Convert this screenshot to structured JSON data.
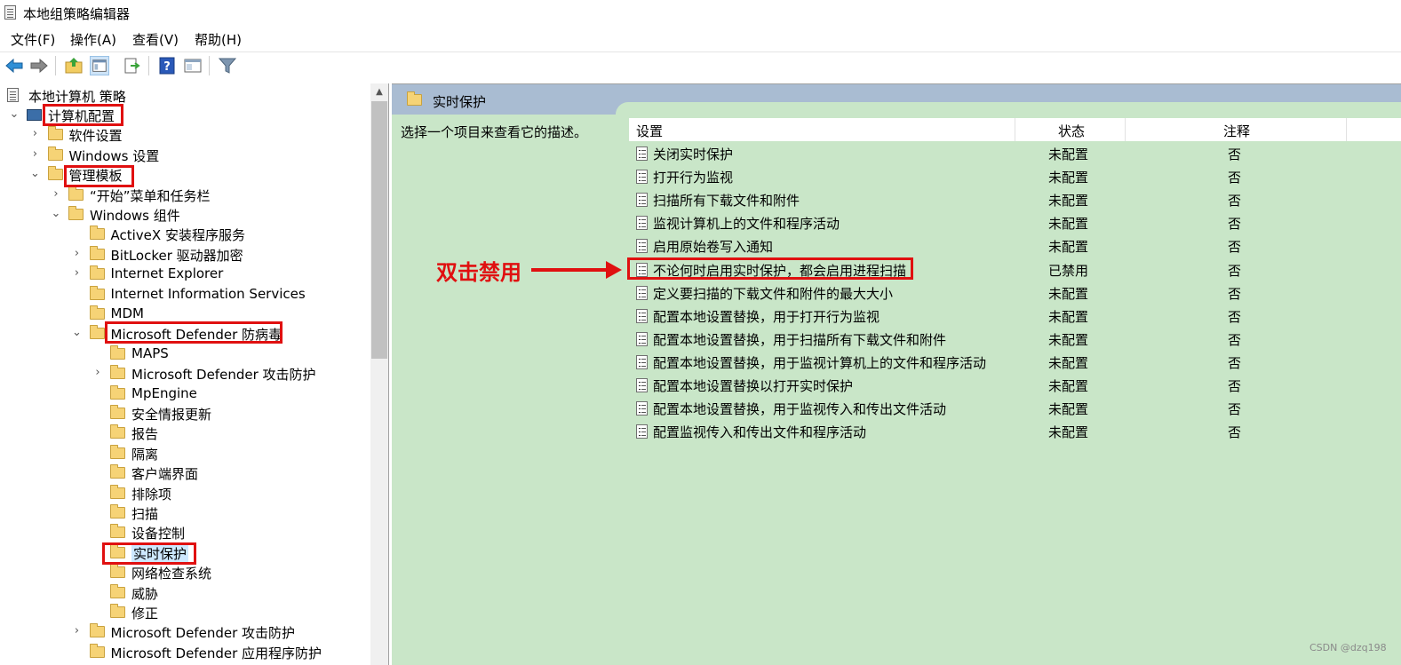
{
  "window": {
    "title": "本地组策略编辑器"
  },
  "menu": [
    "文件(F)",
    "操作(A)",
    "查看(V)",
    "帮助(H)"
  ],
  "toolbar": {
    "buttons": [
      "back-icon",
      "forward-icon",
      "up-folder-icon",
      "show-hide-tree-icon",
      "export-list-icon",
      "help-icon",
      "properties-icon",
      "filter-icon"
    ]
  },
  "tree": {
    "root": "本地计算机 策略",
    "items": [
      {
        "label": "计算机配置",
        "expander": "⌄"
      },
      {
        "label": "软件设置",
        "expander": "›"
      },
      {
        "label": "Windows 设置",
        "expander": "›"
      },
      {
        "label": "管理模板",
        "expander": "⌄"
      },
      {
        "label": "“开始”菜单和任务栏",
        "expander": "›"
      },
      {
        "label": "Windows 组件",
        "expander": "⌄"
      },
      {
        "label": "ActiveX 安装程序服务",
        "expander": ""
      },
      {
        "label": "BitLocker 驱动器加密",
        "expander": "›"
      },
      {
        "label": "Internet Explorer",
        "expander": "›"
      },
      {
        "label": "Internet Information Services",
        "expander": ""
      },
      {
        "label": "MDM",
        "expander": ""
      },
      {
        "label": "Microsoft Defender 防病毒",
        "expander": "⌄"
      },
      {
        "label": "MAPS",
        "expander": ""
      },
      {
        "label": "Microsoft Defender 攻击防护",
        "expander": "›"
      },
      {
        "label": "MpEngine",
        "expander": ""
      },
      {
        "label": "安全情报更新",
        "expander": ""
      },
      {
        "label": "报告",
        "expander": ""
      },
      {
        "label": "隔离",
        "expander": ""
      },
      {
        "label": "客户端界面",
        "expander": ""
      },
      {
        "label": "排除项",
        "expander": ""
      },
      {
        "label": "扫描",
        "expander": ""
      },
      {
        "label": "设备控制",
        "expander": ""
      },
      {
        "label": "实时保护",
        "expander": ""
      },
      {
        "label": "网络检查系统",
        "expander": ""
      },
      {
        "label": "威胁",
        "expander": ""
      },
      {
        "label": "修正",
        "expander": ""
      },
      {
        "label": "Microsoft Defender 攻击防护",
        "expander": "›"
      },
      {
        "label": "Microsoft Defender 应用程序防护",
        "expander": ""
      }
    ]
  },
  "details": {
    "header": "实时保护",
    "description": "选择一个项目来查看它的描述。",
    "columns": {
      "setting": "设置",
      "state": "状态",
      "comment": "注释"
    },
    "rows": [
      {
        "setting": "关闭实时保护",
        "state": "未配置",
        "comment": "否"
      },
      {
        "setting": "打开行为监视",
        "state": "未配置",
        "comment": "否"
      },
      {
        "setting": "扫描所有下载文件和附件",
        "state": "未配置",
        "comment": "否"
      },
      {
        "setting": "监视计算机上的文件和程序活动",
        "state": "未配置",
        "comment": "否"
      },
      {
        "setting": "启用原始卷写入通知",
        "state": "未配置",
        "comment": "否"
      },
      {
        "setting": "不论何时启用实时保护，都会启用进程扫描",
        "state": "已禁用",
        "comment": "否"
      },
      {
        "setting": "定义要扫描的下载文件和附件的最大大小",
        "state": "未配置",
        "comment": "否"
      },
      {
        "setting": "配置本地设置替换，用于打开行为监视",
        "state": "未配置",
        "comment": "否"
      },
      {
        "setting": "配置本地设置替换，用于扫描所有下载文件和附件",
        "state": "未配置",
        "comment": "否"
      },
      {
        "setting": "配置本地设置替换，用于监视计算机上的文件和程序活动",
        "state": "未配置",
        "comment": "否"
      },
      {
        "setting": "配置本地设置替换以打开实时保护",
        "state": "未配置",
        "comment": "否"
      },
      {
        "setting": "配置本地设置替换，用于监视传入和传出文件活动",
        "state": "未配置",
        "comment": "否"
      },
      {
        "setting": "配置监视传入和传出文件和程序活动",
        "state": "未配置",
        "comment": "否"
      }
    ]
  },
  "annotation": {
    "text": "双击禁用",
    "color": "#e01010"
  },
  "watermark": "CSDN @dzq198",
  "colors": {
    "details_bg": "#c9e6c8",
    "band": "#a9bcd2",
    "highlight": "#e01010"
  }
}
